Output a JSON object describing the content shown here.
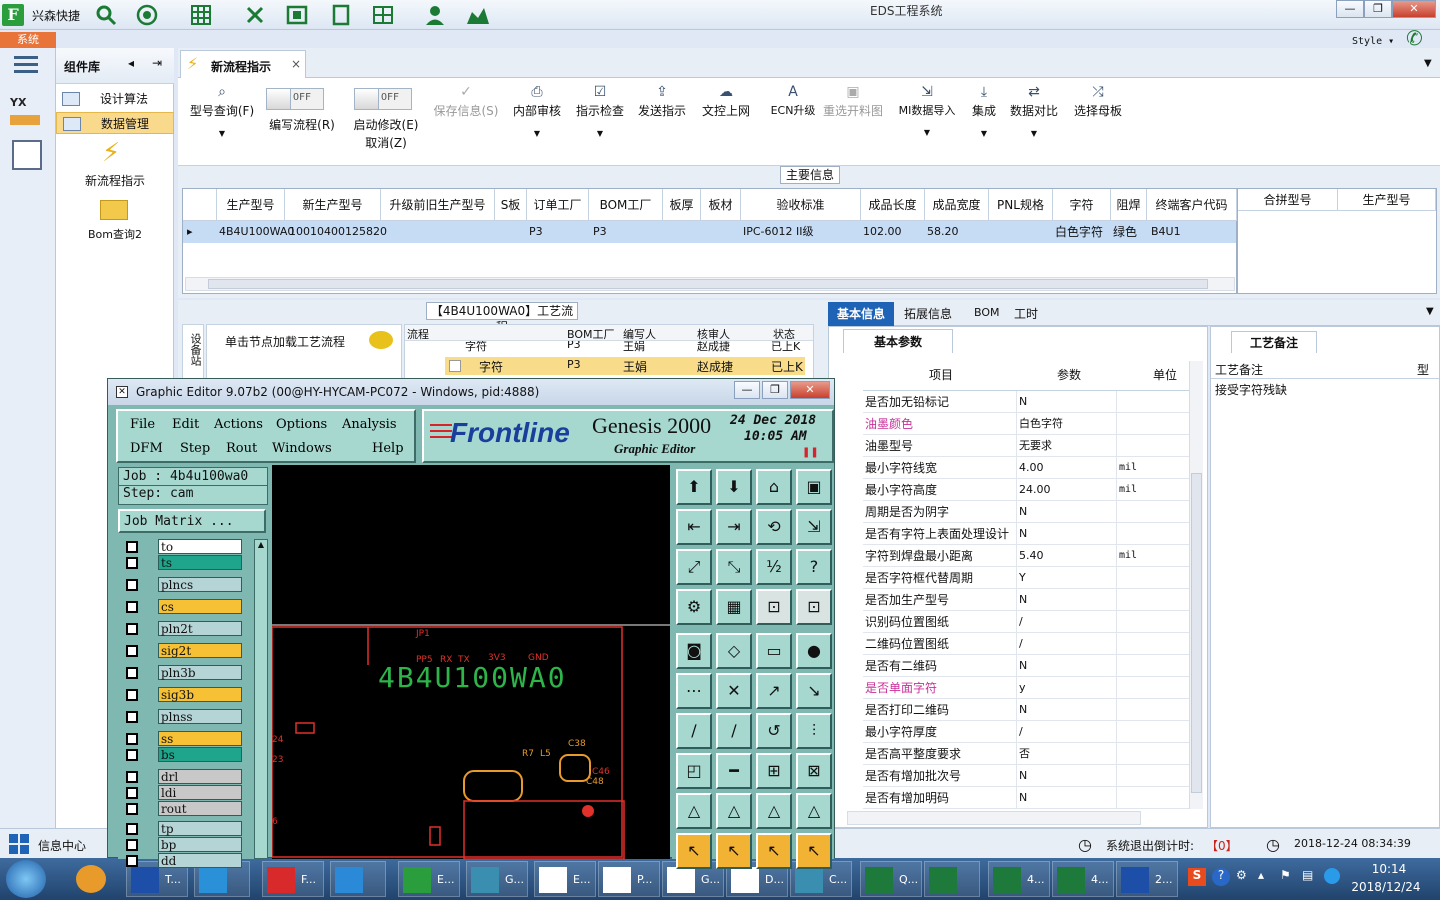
{
  "app": {
    "name": "兴森快捷",
    "window_title": "EDS工程系统",
    "system_tab": "系统",
    "style_label": "Style"
  },
  "sidebar": {
    "header": "组件库",
    "items": [
      {
        "label": "设计算法"
      },
      {
        "label": "数据管理"
      }
    ],
    "launchers": [
      {
        "label": "新流程指示"
      },
      {
        "label": "Bom查询2"
      }
    ]
  },
  "tab": {
    "label": "新流程指示"
  },
  "toolbar": {
    "model_query": "型号查询(F)",
    "edit_flow": "编写流程(R)",
    "enable_modify": "启动修改(E)",
    "cancel": "取消(Z)",
    "toggle_off": "OFF",
    "save_info": "保存信息(S)",
    "internal_review": "内部审核",
    "instruction_check": "指示检查",
    "send_instruction": "发送指示",
    "doc_upload": "文控上网",
    "ecn_upgrade": "ECN升级",
    "reselect_blank": "重选开料图",
    "mi_import": "MI数据导入",
    "integrate": "集成",
    "data_compare": "数据对比",
    "select_mother": "选择母板"
  },
  "main_info": {
    "label": "主要信息",
    "columns": [
      "生产型号",
      "新生产型号",
      "升级前旧生产型号",
      "S板",
      "订单工厂",
      "BOM工厂",
      "板厚",
      "板材",
      "验收标准",
      "成品长度",
      "成品宽度",
      "PNL规格",
      "字符",
      "阻焊",
      "终端客户代码"
    ],
    "row": [
      "4B4U100WA0",
      "10010400125820",
      "",
      "",
      "P3",
      "P3",
      "",
      "",
      "IPC-6012 II级",
      "102.00",
      "58.20",
      "",
      "白色字符",
      "绿色",
      "B4U1"
    ],
    "right_columns": [
      "合拼型号",
      "生产型号"
    ]
  },
  "process": {
    "label": "【4B4U100WA0】工艺流程",
    "hint": "单击节点加载工艺流程",
    "side_label": "设备站",
    "columns": [
      "流程",
      "BOM工厂",
      "编写人",
      "核审人",
      "状态"
    ],
    "rows": [
      {
        "name": "字符",
        "factory": "P3",
        "author": "王娟",
        "reviewer": "赵成捷",
        "status": "已上K"
      },
      {
        "name": "字符",
        "factory": "P3",
        "author": "王娟",
        "reviewer": "赵成捷",
        "status": "已上K"
      }
    ]
  },
  "right_tabs": [
    "基本信息",
    "拓展信息",
    "BOM",
    "工时"
  ],
  "params": {
    "sub_tab": "基本参数",
    "columns": [
      "项目",
      "参数",
      "单位"
    ],
    "rows": [
      {
        "item": "是否加无铅标记",
        "value": "N",
        "unit": "",
        "highlight": false
      },
      {
        "item": "油墨颜色",
        "value": "白色字符",
        "unit": "",
        "highlight": true
      },
      {
        "item": "油墨型号",
        "value": "无要求",
        "unit": "",
        "highlight": false
      },
      {
        "item": "最小字符线宽",
        "value": "4.00",
        "unit": "mil",
        "highlight": false
      },
      {
        "item": "最小字符高度",
        "value": "24.00",
        "unit": "mil",
        "highlight": false
      },
      {
        "item": "周期是否为阴字",
        "value": "N",
        "unit": "",
        "highlight": false
      },
      {
        "item": "是否有字符上表面处理设计",
        "value": "N",
        "unit": "",
        "highlight": false
      },
      {
        "item": "字符到焊盘最小距离",
        "value": "5.40",
        "unit": "mil",
        "highlight": false
      },
      {
        "item": "是否字符框代替周期",
        "value": "Y",
        "unit": "",
        "highlight": false
      },
      {
        "item": "是否加生产型号",
        "value": "N",
        "unit": "",
        "highlight": false
      },
      {
        "item": "识别码位置图纸",
        "value": "/",
        "unit": "",
        "highlight": false
      },
      {
        "item": "二维码位置图纸",
        "value": "/",
        "unit": "",
        "highlight": false
      },
      {
        "item": "是否有二维码",
        "value": "N",
        "unit": "",
        "highlight": false
      },
      {
        "item": "是否单面字符",
        "value": "y",
        "unit": "",
        "highlight": true
      },
      {
        "item": "是否打印二维码",
        "value": "N",
        "unit": "",
        "highlight": false
      },
      {
        "item": "最小字符厚度",
        "value": "/",
        "unit": "",
        "highlight": false
      },
      {
        "item": "是否高平整度要求",
        "value": "否",
        "unit": "",
        "highlight": false
      },
      {
        "item": "是否有增加批次号",
        "value": "N",
        "unit": "",
        "highlight": false
      },
      {
        "item": "是否有增加明码",
        "value": "N",
        "unit": "",
        "highlight": false
      }
    ]
  },
  "remarks": {
    "tab": "工艺备注",
    "col1": "工艺备注",
    "col2": "型",
    "text": "接受字符残缺"
  },
  "status_bar": {
    "info_center": "信息中心",
    "logout_label": "系统退出倒计时:",
    "logout_value": "【0】",
    "datetime": "2018-12-24 08:34:39"
  },
  "editor": {
    "title": "Graphic Editor 9.07b2 (00@HY-HYCAM-PC072 - Windows, pid:4888)",
    "menu_row1": [
      "File",
      "Edit",
      "Actions",
      "Options",
      "Analysis"
    ],
    "menu_row2": [
      "DFM",
      "Step",
      "Rout",
      "Windows",
      "Help"
    ],
    "brand": "Frontline",
    "product": "Genesis 2000",
    "subtitle": "Graphic Editor",
    "date": "24 Dec 2018",
    "time": "10:05 AM",
    "job": "Job : 4b4u100wa0",
    "step": "Step: cam",
    "job_matrix": "Job Matrix ...",
    "canvas_text": "4B4U100WA0",
    "labels": [
      "JP1",
      "PP5",
      "RX",
      "TX",
      "3V3",
      "GND",
      "R7",
      "L5",
      "C38",
      "C46",
      "C48",
      "24",
      "23",
      "6"
    ],
    "layers": [
      {
        "name": "to",
        "color": "#ffffff"
      },
      {
        "name": "ts",
        "color": "#1fa58b"
      },
      {
        "name": "plncs",
        "color": "#b5d4d6"
      },
      {
        "name": "cs",
        "color": "#f6c134"
      },
      {
        "name": "pln2t",
        "color": "#b5d4d6"
      },
      {
        "name": "sig2t",
        "color": "#f6c134"
      },
      {
        "name": "pln3b",
        "color": "#b5d4d6"
      },
      {
        "name": "sig3b",
        "color": "#f6c134"
      },
      {
        "name": "plnss",
        "color": "#b5d4d6"
      },
      {
        "name": "ss",
        "color": "#f6c134"
      },
      {
        "name": "bs",
        "color": "#1fa58b"
      },
      {
        "name": "drl",
        "color": "#c8c8c8"
      },
      {
        "name": "ldi",
        "color": "#c8c8c8"
      },
      {
        "name": "rout",
        "color": "#c8c8c8"
      },
      {
        "name": "tp",
        "color": "#b5d4d6"
      },
      {
        "name": "bp",
        "color": "#b5d4d6"
      },
      {
        "name": "dd",
        "color": "#b5d4d6"
      }
    ]
  },
  "taskbar": {
    "apps": [
      "T...",
      "F...",
      "E...",
      "G...",
      "E...",
      "P...",
      "G...",
      "D...",
      "C...",
      "Q...",
      "4...",
      "4...",
      "2..."
    ],
    "time": "10:14",
    "date": "2018/12/24"
  },
  "colors": {
    "accent": "#1e63b6",
    "highlight_row": "#c6dcf5",
    "pink_text": "#c8309a",
    "canvas_green": "#2db54a",
    "canvas_red": "#e0312a"
  }
}
